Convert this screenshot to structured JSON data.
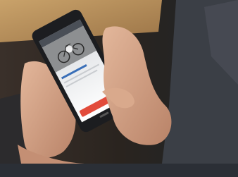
{
  "photo": {
    "subject": "hands-holding-smartphone",
    "colors": {
      "table": "#c9a26a",
      "background_dark": "#2a241f",
      "jacket": "#3b3f46",
      "phone_body": "#1c1d20",
      "app_button": "#e24b3b",
      "skin": "#d8a88a"
    }
  },
  "phone_ui": {
    "header_text": "",
    "link_text": ""
  }
}
